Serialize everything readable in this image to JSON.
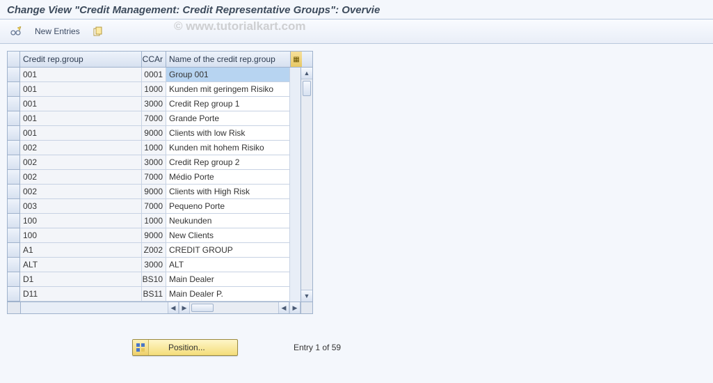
{
  "title": "Change View \"Credit Management: Credit Representative Groups\": Overvie",
  "watermark": "© www.tutorialkart.com",
  "toolbar": {
    "other_view_icon": "other-view-icon",
    "new_entries_label": "New Entries",
    "copy_icon": "copy-icon"
  },
  "grid": {
    "headers": {
      "group": "Credit rep.group",
      "ccar": "CCAr",
      "name": "Name of the credit rep.group"
    },
    "selected_index": 0,
    "rows": [
      {
        "group": "001",
        "ccar": "0001",
        "name": "Group 001"
      },
      {
        "group": "001",
        "ccar": "1000",
        "name": "Kunden mit geringem Risiko"
      },
      {
        "group": "001",
        "ccar": "3000",
        "name": "Credit Rep group 1"
      },
      {
        "group": "001",
        "ccar": "7000",
        "name": "Grande Porte"
      },
      {
        "group": "001",
        "ccar": "9000",
        "name": "Clients with low Risk"
      },
      {
        "group": "002",
        "ccar": "1000",
        "name": "Kunden mit hohem Risiko"
      },
      {
        "group": "002",
        "ccar": "3000",
        "name": "Credit Rep group 2"
      },
      {
        "group": "002",
        "ccar": "7000",
        "name": "Médio Porte"
      },
      {
        "group": "002",
        "ccar": "9000",
        "name": "Clients with High Risk"
      },
      {
        "group": "003",
        "ccar": "7000",
        "name": "Pequeno Porte"
      },
      {
        "group": "100",
        "ccar": "1000",
        "name": "Neukunden"
      },
      {
        "group": "100",
        "ccar": "9000",
        "name": "New Clients"
      },
      {
        "group": "A1",
        "ccar": "Z002",
        "name": "CREDIT GROUP"
      },
      {
        "group": "ALT",
        "ccar": "3000",
        "name": "ALT"
      },
      {
        "group": "D1",
        "ccar": "BS10",
        "name": "Main Dealer"
      },
      {
        "group": "D11",
        "ccar": "BS11",
        "name": "Main Dealer P."
      }
    ]
  },
  "footer": {
    "position_label": "Position...",
    "entry_text": "Entry 1 of 59"
  }
}
